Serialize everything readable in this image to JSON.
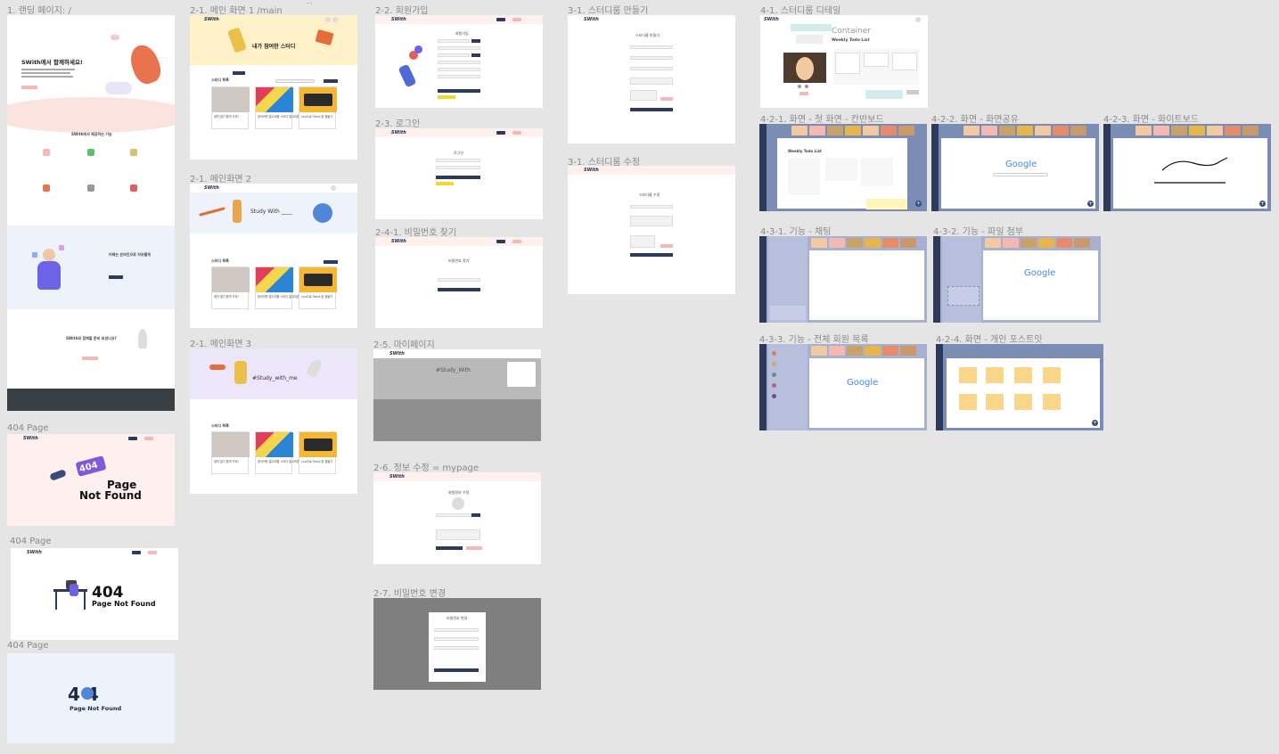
{
  "canvas": {
    "labels": {
      "landing": "1. 랜딩 페이지: /",
      "main1": "2-1. 메인 화면 1 /main",
      "main2": "2-1. 메인화면 2",
      "main3": "2-1. 메인화면 3",
      "signup": "2-2. 회원가입",
      "login": "2-3. 로그인",
      "findpw": "2-4-1. 비밀번호 찾기",
      "mypage": "2-5. 마이페이지",
      "editinfo": "2-6. 정보 수정 = mypage",
      "changepw": "2-7. 비밀번호 변경",
      "createroom": "3-1. 스터디룸 만들기",
      "editroom": "3-1. 스터디룸 수정",
      "roomdetail": "4-1. 스터디룸 디테일",
      "kanban": "4-2-1. 화면 - 첫 화면 - 칸반보드",
      "screenshare": "4-2-2. 화면 - 화면공유",
      "whiteboard": "4-2-3. 화면 - 화이트보드",
      "chat": "4-3-1. 기능 - 채팅",
      "fileshare": "4-3-2. 기능 - 파일 첨부",
      "members": "4-3-3. 기능 - 전체 회원 목록",
      "postit": "4-2-4. 화면 - 개인 포스트잇",
      "p404a": "404 Page",
      "p404b": "404 Page",
      "p404c": "404 Page"
    },
    "dots": "..."
  },
  "app": {
    "logo": "SWith",
    "colors": {
      "navy": "#2e3a5b",
      "pink": "#f4b9b2",
      "peach": "#fdf0ef",
      "yellow": "#fff1c7",
      "lavender": "#ece6fb",
      "lightblue": "#eef3fb",
      "dashboard": "#7b8db5"
    }
  },
  "landing": {
    "hero_title": "SWith에서 함께하세요!",
    "features_title": "SWith에서 제공하는 기능",
    "section3_title": "어제는 온라인으로 자유롭게",
    "section4_title": "SWith와 함께할 준비 되셨나요?"
  },
  "main": {
    "banner1": "내가 참여한 스터디",
    "banner2": "Study With ____",
    "banner3": "#Study_with_me",
    "list_title": "스터디 목록",
    "cards": [
      {
        "title": "정처 필기 합격 가자!"
      },
      {
        "title": "한국어를 알고리즘 스터디 알고리즘"
      },
      {
        "title": "cnn으로 Trend 완 점들기"
      }
    ]
  },
  "forms": {
    "signup_title": "회원가입",
    "login_title": "로그인",
    "findpw_title": "비밀번호 찾기",
    "mypage_banner": "#Study_With",
    "editinfo_title": "회원정보 수정",
    "changepw_title": "비밀번호 변경",
    "createroom_title": "스터디룸 만들기",
    "editroom_title": "스터디룸 수정"
  },
  "detail": {
    "container_label": "Container",
    "todo_title": "Weekly Todo List"
  },
  "dashboard": {
    "todo_title": "Weekly Todo List",
    "google_logo": "Google",
    "plus": "+"
  },
  "errors": {
    "a_code": "404",
    "a_text_1": "Page",
    "a_text_2": "Not Found",
    "b_code": "404",
    "b_text": "Page Not Found",
    "c_code": "4 4",
    "c_text": "Page Not Found"
  }
}
